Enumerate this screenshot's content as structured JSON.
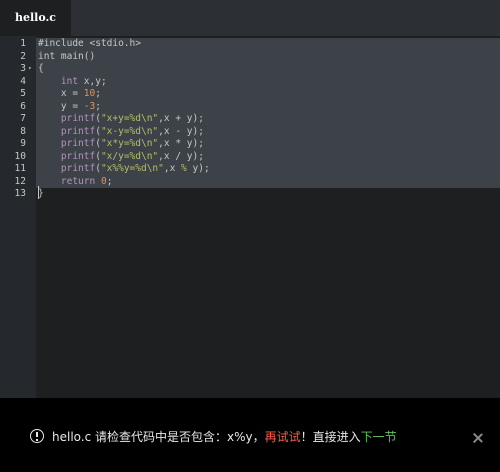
{
  "tab": {
    "label": "hello.c"
  },
  "editor": {
    "lines": [
      {
        "num": "1",
        "tokens": [
          [
            "plain",
            "#include <stdio.h>"
          ]
        ]
      },
      {
        "num": "2",
        "tokens": [
          [
            "plain",
            "int main()"
          ]
        ]
      },
      {
        "num": "3",
        "tokens": [
          [
            "plain",
            "{"
          ]
        ],
        "fold": "▾"
      },
      {
        "num": "4",
        "tokens": [
          [
            "plain",
            "    "
          ],
          [
            "kw",
            "int"
          ],
          [
            "plain",
            " x,y;"
          ]
        ]
      },
      {
        "num": "5",
        "tokens": [
          [
            "plain",
            "    x = "
          ],
          [
            "num",
            "10"
          ],
          [
            "plain",
            ";"
          ]
        ]
      },
      {
        "num": "6",
        "tokens": [
          [
            "plain",
            "    y = "
          ],
          [
            "num",
            "-3"
          ],
          [
            "plain",
            ";"
          ]
        ]
      },
      {
        "num": "7",
        "tokens": [
          [
            "plain",
            "    "
          ],
          [
            "kw",
            "printf"
          ],
          [
            "plain",
            "("
          ],
          [
            "str",
            "\"x+y=%d\\n\""
          ],
          [
            "plain",
            ",x + y);"
          ]
        ]
      },
      {
        "num": "8",
        "tokens": [
          [
            "plain",
            "    "
          ],
          [
            "kw",
            "printf"
          ],
          [
            "plain",
            "("
          ],
          [
            "str",
            "\"x-y=%d\\n\""
          ],
          [
            "plain",
            ",x - y);"
          ]
        ]
      },
      {
        "num": "9",
        "tokens": [
          [
            "plain",
            "    "
          ],
          [
            "kw",
            "printf"
          ],
          [
            "plain",
            "("
          ],
          [
            "str",
            "\"x*y=%d\\n\""
          ],
          [
            "plain",
            ",x * y);"
          ]
        ]
      },
      {
        "num": "10",
        "tokens": [
          [
            "plain",
            "    "
          ],
          [
            "kw",
            "printf"
          ],
          [
            "plain",
            "("
          ],
          [
            "str",
            "\"x/y=%d\\n\""
          ],
          [
            "plain",
            ",x / y);"
          ]
        ]
      },
      {
        "num": "11",
        "tokens": [
          [
            "plain",
            "    "
          ],
          [
            "kw",
            "printf"
          ],
          [
            "plain",
            "("
          ],
          [
            "str",
            "\"x%%y=%d\\n\""
          ],
          [
            "plain",
            ",x "
          ],
          [
            "str",
            "%"
          ],
          [
            "plain",
            " y);"
          ]
        ]
      },
      {
        "num": "12",
        "tokens": [
          [
            "plain",
            "    "
          ],
          [
            "kw",
            "return"
          ],
          [
            "plain",
            " "
          ],
          [
            "num",
            "0"
          ],
          [
            "plain",
            ";"
          ]
        ]
      },
      {
        "num": "13",
        "tokens": [
          [
            "plain",
            "}"
          ]
        ]
      }
    ]
  },
  "notice": {
    "icon": "alert-circle-icon",
    "prefix": "hello.c 请检查代码中是否包含：x%y，",
    "retry": "再试试",
    "middle": "！直接进入",
    "next": "下一节",
    "close_icon": "close-icon"
  },
  "colors": {
    "retry": "#ff5b4d",
    "next": "#59c25a"
  }
}
